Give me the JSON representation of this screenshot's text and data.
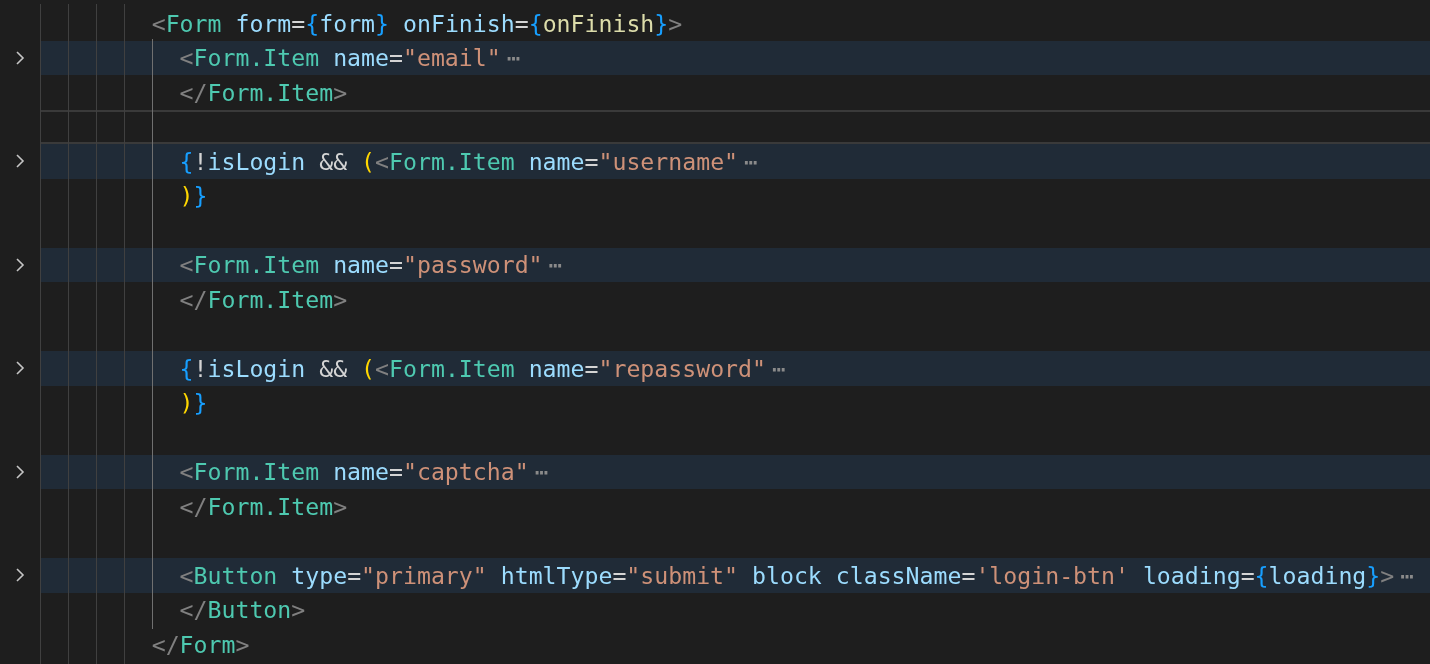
{
  "editor": {
    "lines": [
      {
        "folded": false,
        "current": false,
        "tokens": [
          {
            "kind": "punct",
            "text": "<"
          },
          {
            "kind": "component",
            "text": "Form"
          },
          {
            "kind": "attr",
            "text": " form"
          },
          {
            "kind": "op",
            "text": "="
          },
          {
            "kind": "brace",
            "text": "{"
          },
          {
            "kind": "var",
            "text": "form"
          },
          {
            "kind": "brace",
            "text": "}"
          },
          {
            "kind": "attr",
            "text": " onFinish"
          },
          {
            "kind": "op",
            "text": "="
          },
          {
            "kind": "brace",
            "text": "{"
          },
          {
            "kind": "func",
            "text": "onFinish"
          },
          {
            "kind": "brace",
            "text": "}"
          },
          {
            "kind": "punct",
            "text": ">"
          }
        ],
        "children": [
          {
            "folded": true,
            "current": false,
            "tokens": [
              {
                "kind": "punct",
                "text": "<"
              },
              {
                "kind": "component",
                "text": "Form.Item"
              },
              {
                "kind": "attr",
                "text": " name"
              },
              {
                "kind": "op",
                "text": "="
              },
              {
                "kind": "string",
                "text": "\"email\""
              }
            ],
            "fold_marker": "⋯"
          },
          {
            "folded": false,
            "current": false,
            "tokens": [
              {
                "kind": "punct",
                "text": "</"
              },
              {
                "kind": "component",
                "text": "Form.Item"
              },
              {
                "kind": "punct",
                "text": ">"
              }
            ]
          },
          {
            "folded": false,
            "current": true
          },
          {
            "folded": true,
            "current": false,
            "tokens": [
              {
                "kind": "brace",
                "text": "{"
              },
              {
                "kind": "op",
                "text": "!"
              },
              {
                "kind": "var",
                "text": "isLogin"
              },
              {
                "kind": "op",
                "text": " &&"
              },
              {
                "kind": "paren",
                "text": " ("
              },
              {
                "kind": "punct",
                "text": "<"
              },
              {
                "kind": "component",
                "text": "Form.Item"
              },
              {
                "kind": "attr",
                "text": " name"
              },
              {
                "kind": "op",
                "text": "="
              },
              {
                "kind": "string",
                "text": "\"username\""
              }
            ],
            "fold_marker": "⋯"
          },
          {
            "folded": false,
            "current": false,
            "tokens": [
              {
                "kind": "paren",
                "text": ")"
              },
              {
                "kind": "brace",
                "text": "}"
              }
            ]
          },
          {
            "folded": false,
            "current": false
          },
          {
            "folded": true,
            "current": false,
            "tokens": [
              {
                "kind": "punct",
                "text": "<"
              },
              {
                "kind": "component",
                "text": "Form.Item"
              },
              {
                "kind": "attr",
                "text": " name"
              },
              {
                "kind": "op",
                "text": "="
              },
              {
                "kind": "string",
                "text": "\"password\""
              }
            ],
            "fold_marker": "⋯"
          },
          {
            "folded": false,
            "current": false,
            "tokens": [
              {
                "kind": "punct",
                "text": "</"
              },
              {
                "kind": "component",
                "text": "Form.Item"
              },
              {
                "kind": "punct",
                "text": ">"
              }
            ]
          },
          {
            "folded": false,
            "current": false
          },
          {
            "folded": true,
            "current": false,
            "tokens": [
              {
                "kind": "brace",
                "text": "{"
              },
              {
                "kind": "op",
                "text": "!"
              },
              {
                "kind": "var",
                "text": "isLogin"
              },
              {
                "kind": "op",
                "text": " &&"
              },
              {
                "kind": "paren",
                "text": " ("
              },
              {
                "kind": "punct",
                "text": "<"
              },
              {
                "kind": "component",
                "text": "Form.Item"
              },
              {
                "kind": "attr",
                "text": " name"
              },
              {
                "kind": "op",
                "text": "="
              },
              {
                "kind": "string",
                "text": "\"repassword\""
              }
            ],
            "fold_marker": "⋯"
          },
          {
            "folded": false,
            "current": false,
            "tokens": [
              {
                "kind": "paren",
                "text": ")"
              },
              {
                "kind": "brace",
                "text": "}"
              }
            ]
          },
          {
            "folded": false,
            "current": false
          },
          {
            "folded": true,
            "current": false,
            "tokens": [
              {
                "kind": "punct",
                "text": "<"
              },
              {
                "kind": "component",
                "text": "Form.Item"
              },
              {
                "kind": "attr",
                "text": " name"
              },
              {
                "kind": "op",
                "text": "="
              },
              {
                "kind": "string",
                "text": "\"captcha\""
              }
            ],
            "fold_marker": "⋯"
          },
          {
            "folded": false,
            "current": false,
            "tokens": [
              {
                "kind": "punct",
                "text": "</"
              },
              {
                "kind": "component",
                "text": "Form.Item"
              },
              {
                "kind": "punct",
                "text": ">"
              }
            ]
          },
          {
            "folded": false,
            "current": false
          },
          {
            "folded": true,
            "current": false,
            "tokens": [
              {
                "kind": "punct",
                "text": "<"
              },
              {
                "kind": "component",
                "text": "Button"
              },
              {
                "kind": "attr",
                "text": " type"
              },
              {
                "kind": "op",
                "text": "="
              },
              {
                "kind": "string",
                "text": "\"primary\""
              },
              {
                "kind": "attr",
                "text": " htmlType"
              },
              {
                "kind": "op",
                "text": "="
              },
              {
                "kind": "string",
                "text": "\"submit\""
              },
              {
                "kind": "attr",
                "text": " block"
              },
              {
                "kind": "attr",
                "text": " className"
              },
              {
                "kind": "op",
                "text": "="
              },
              {
                "kind": "string",
                "text": "'login-btn'"
              },
              {
                "kind": "attr",
                "text": " loading"
              },
              {
                "kind": "op",
                "text": "="
              },
              {
                "kind": "brace",
                "text": "{"
              },
              {
                "kind": "var",
                "text": "loading"
              },
              {
                "kind": "brace",
                "text": "}"
              },
              {
                "kind": "punct",
                "text": ">"
              }
            ],
            "fold_marker": "⋯"
          },
          {
            "folded": false,
            "current": false,
            "tokens": [
              {
                "kind": "punct",
                "text": "</"
              },
              {
                "kind": "component",
                "text": "Button"
              },
              {
                "kind": "punct",
                "text": ">"
              }
            ]
          }
        ]
      },
      {
        "folded": false,
        "current": false,
        "tokens": [
          {
            "kind": "punct",
            "text": "</"
          },
          {
            "kind": "component",
            "text": "Form"
          },
          {
            "kind": "punct",
            "text": ">"
          }
        ]
      }
    ]
  }
}
